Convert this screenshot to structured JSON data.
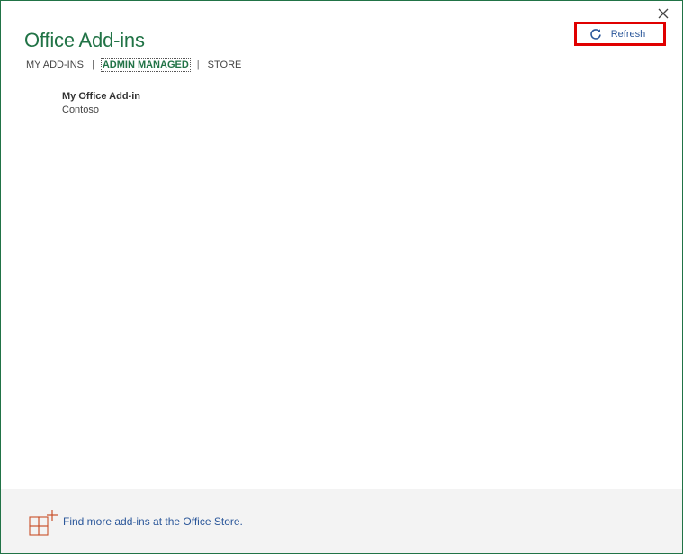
{
  "dialog": {
    "title": "Office Add-ins",
    "close_icon": "close-icon"
  },
  "tabs": [
    {
      "label": "MY ADD-INS",
      "active": false
    },
    {
      "label": "ADMIN MANAGED",
      "active": true
    },
    {
      "label": "STORE",
      "active": false
    }
  ],
  "tab_separator": "|",
  "toolbar": {
    "refresh_label": "Refresh",
    "refresh_icon": "refresh-icon"
  },
  "addins": [
    {
      "name": "My Office Add-in",
      "publisher": "Contoso"
    }
  ],
  "footer": {
    "store_link": "Find more add-ins at the Office Store.",
    "store_icon": "store-grid-plus-icon"
  },
  "colors": {
    "accent": "#217346",
    "link": "#2b579a",
    "highlight": "#e00000",
    "footer_bg": "#f3f3f3"
  }
}
